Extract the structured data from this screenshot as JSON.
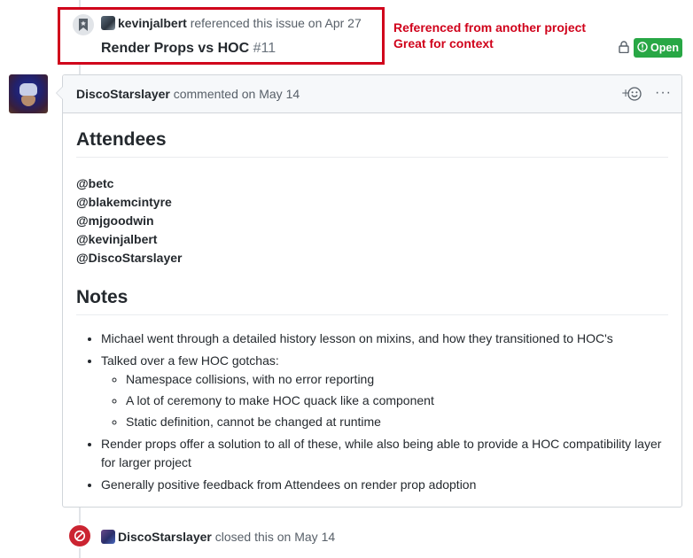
{
  "reference_event": {
    "author": "kevinjalbert",
    "action": "referenced this issue on",
    "date": "Apr 27",
    "issue_title": "Render Props vs HOC",
    "issue_number": "#11",
    "icon": "bookmark-icon"
  },
  "annotation": {
    "line1": "Referenced from another project",
    "line2": "Great for context"
  },
  "issue_state": {
    "label": "Open",
    "color": "#28a745",
    "lock_icon": "lock-icon"
  },
  "comment": {
    "author": "DiscoStarslayer",
    "action": "commented on",
    "date": "May 14",
    "heading_attendees": "Attendees",
    "attendees": [
      "@betc",
      "@blakemcintyre",
      "@mjgoodwin",
      "@kevinjalbert",
      "@DiscoStarslayer"
    ],
    "heading_notes": "Notes",
    "notes": [
      "Michael went through a detailed history lesson on mixins, and how they transitioned to HOC's",
      "Talked over a few HOC gotchas:",
      "Render props offer a solution to all of these, while also being able to provide a HOC compatibility layer for larger project",
      "Generally positive feedback from Attendees on render prop adoption"
    ],
    "gotchas": [
      "Namespace collisions, with no error reporting",
      "A lot of ceremony to make HOC quack like a component",
      "Static definition, cannot be changed at runtime"
    ],
    "more_label": "···"
  },
  "closed_event": {
    "author": "DiscoStarslayer",
    "action": "closed this on",
    "date": "May 14",
    "color": "#cb2431"
  },
  "colors": {
    "annotation": "#d0021b",
    "open": "#28a745",
    "closed": "#cb2431"
  }
}
